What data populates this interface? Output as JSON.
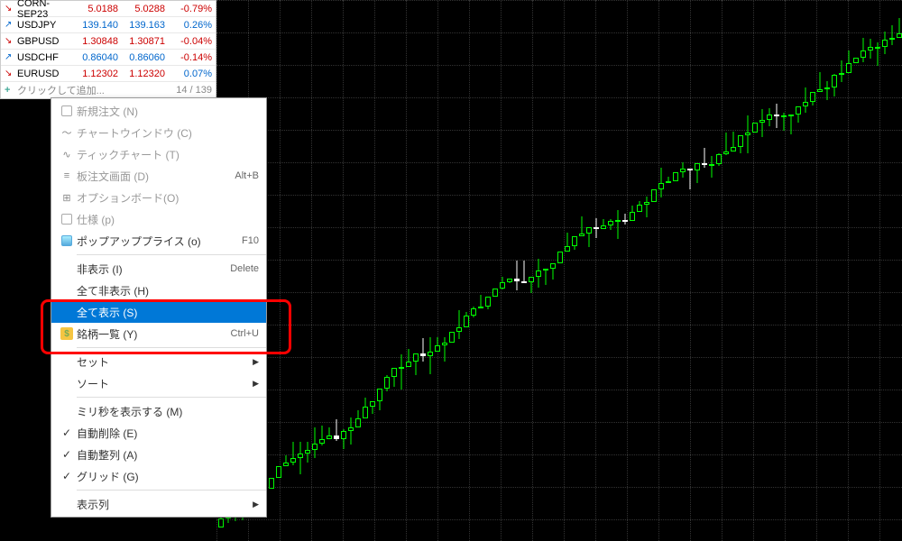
{
  "watchlist": {
    "rows": [
      {
        "dir": "down",
        "name": "CORN-SEP23",
        "bid": "5.0188",
        "ask": "5.0288",
        "pct": "-0.79%",
        "color": "red"
      },
      {
        "dir": "up",
        "name": "USDJPY",
        "bid": "139.140",
        "ask": "139.163",
        "pct": "0.26%",
        "color": "blue"
      },
      {
        "dir": "down",
        "name": "GBPUSD",
        "bid": "1.30848",
        "ask": "1.30871",
        "pct": "-0.04%",
        "color": "red"
      },
      {
        "dir": "up",
        "name": "USDCHF",
        "bid": "0.86040",
        "ask": "0.86060",
        "pct": "-0.14%",
        "color": "blue"
      },
      {
        "dir": "down",
        "name": "EURUSD",
        "bid": "1.12302",
        "ask": "1.12320",
        "pct": "0.07%",
        "color": "red"
      }
    ],
    "add_label": "クリックして追加...",
    "counter": "14 / 139"
  },
  "context_menu": {
    "items": [
      {
        "icon": "doc",
        "label": "新規注文 (N)",
        "shortcut": ""
      },
      {
        "icon": "chart",
        "label": "チャートウインドウ (C)",
        "shortcut": ""
      },
      {
        "icon": "tick",
        "label": "ティックチャート (T)",
        "shortcut": ""
      },
      {
        "icon": "depth",
        "label": "板注文画面 (D)",
        "shortcut": "Alt+B"
      },
      {
        "icon": "option",
        "label": "オプションボード(O)",
        "shortcut": ""
      },
      {
        "icon": "spec",
        "label": "仕様 (p)",
        "shortcut": ""
      },
      {
        "icon": "popup",
        "label": "ポップアッププライス (o)",
        "shortcut": "F10"
      },
      {
        "sep": true
      },
      {
        "icon": "",
        "label": "非表示 (I)",
        "shortcut": "Delete"
      },
      {
        "icon": "",
        "label": "全て非表示 (H)",
        "shortcut": ""
      },
      {
        "icon": "",
        "label": "全て表示 (S)",
        "shortcut": "",
        "highlighted": true
      },
      {
        "icon": "dollar",
        "label": "銘柄一覧 (Y)",
        "shortcut": "Ctrl+U"
      },
      {
        "sep": true
      },
      {
        "icon": "",
        "label": "セット",
        "submenu": true
      },
      {
        "icon": "",
        "label": "ソート",
        "submenu": true
      },
      {
        "sep": true
      },
      {
        "icon": "",
        "label": "ミリ秒を表示する (M)",
        "shortcut": ""
      },
      {
        "icon": "check",
        "label": "自動削除 (E)",
        "shortcut": ""
      },
      {
        "icon": "check",
        "label": "自動整列 (A)",
        "shortcut": ""
      },
      {
        "icon": "check",
        "label": "グリッド (G)",
        "shortcut": ""
      },
      {
        "sep": true
      },
      {
        "icon": "",
        "label": "表示列",
        "submenu": true
      }
    ]
  },
  "chart_data": {
    "type": "candlestick",
    "note": "uptrending price series, approx values on relative scale",
    "colors": {
      "up_candle": "#00ff00",
      "down_candle": "#ffffff",
      "background": "#000000",
      "grid": "#333333"
    }
  }
}
